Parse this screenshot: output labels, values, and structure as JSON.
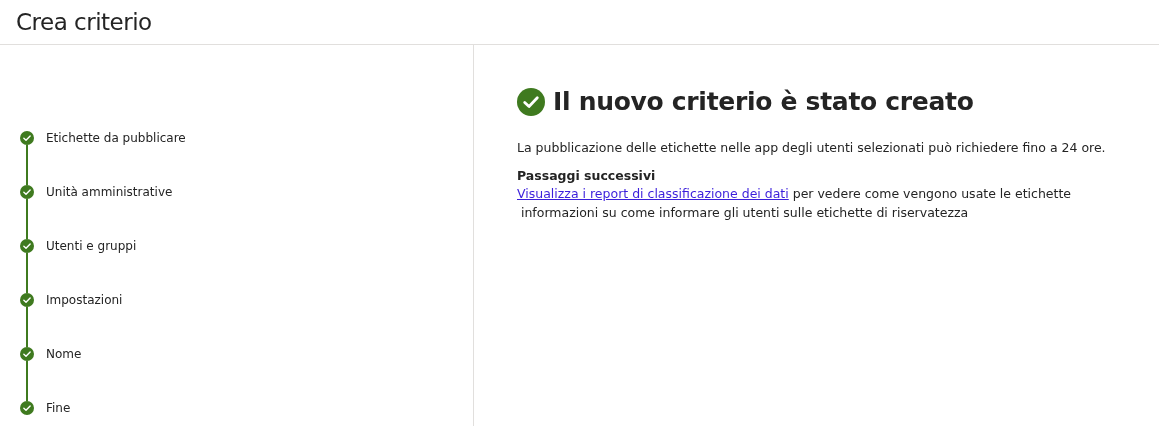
{
  "page": {
    "title": "Crea criterio"
  },
  "steps": [
    {
      "label": "Etichette da pubblicare",
      "completed": true
    },
    {
      "label": "Unità amministrative",
      "completed": true
    },
    {
      "label": "Utenti e gruppi",
      "completed": true
    },
    {
      "label": "Impostazioni",
      "completed": true
    },
    {
      "label": "Nome",
      "completed": true
    },
    {
      "label": "Fine",
      "completed": true
    }
  ],
  "result": {
    "heading": "Il nuovo criterio è stato creato",
    "message": "La pubblicazione delle etichette nelle app degli utenti selezionati può richiedere fino a 24 ore.",
    "next_steps_title": "Passaggi successivi",
    "link": "Visualizza i report di classificazione dei dati",
    "link_suffix": " per vedere come vengono usate le etichette",
    "note": " informazioni su come informare gli utenti sulle etichette di riservatezza"
  }
}
